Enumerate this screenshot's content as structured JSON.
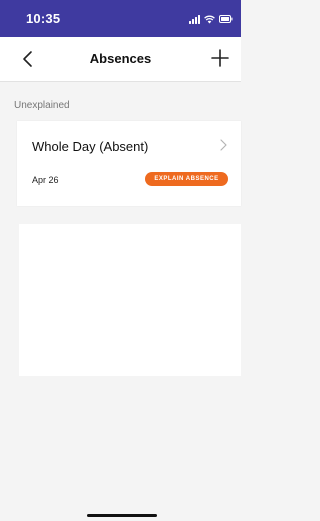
{
  "status_bar": {
    "time": "10:35",
    "background": "#3f3aa0"
  },
  "nav": {
    "title": "Absences",
    "back_icon": "chevron-left",
    "add_icon": "plus"
  },
  "section": {
    "header": "Unexplained"
  },
  "absence_card": {
    "title": "Whole Day (Absent)",
    "date": "Apr 26",
    "action_label": "EXPLAIN ABSENCE",
    "action_color": "#ee6a1f"
  }
}
